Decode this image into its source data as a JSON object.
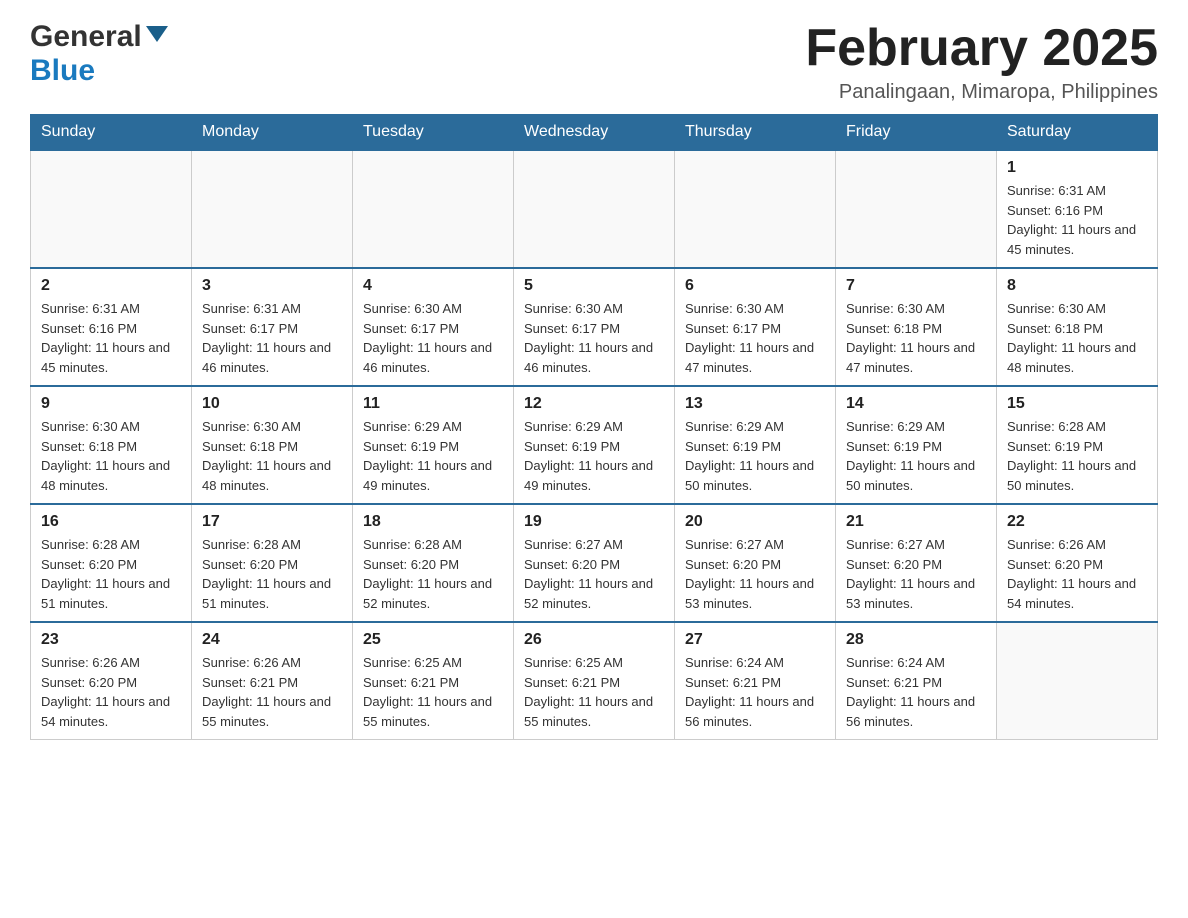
{
  "logo": {
    "general": "General",
    "blue": "Blue"
  },
  "header": {
    "title": "February 2025",
    "subtitle": "Panalingaan, Mimaropa, Philippines"
  },
  "days_of_week": [
    "Sunday",
    "Monday",
    "Tuesday",
    "Wednesday",
    "Thursday",
    "Friday",
    "Saturday"
  ],
  "weeks": [
    {
      "days": [
        {
          "number": "",
          "info": ""
        },
        {
          "number": "",
          "info": ""
        },
        {
          "number": "",
          "info": ""
        },
        {
          "number": "",
          "info": ""
        },
        {
          "number": "",
          "info": ""
        },
        {
          "number": "",
          "info": ""
        },
        {
          "number": "1",
          "info": "Sunrise: 6:31 AM\nSunset: 6:16 PM\nDaylight: 11 hours and 45 minutes."
        }
      ]
    },
    {
      "days": [
        {
          "number": "2",
          "info": "Sunrise: 6:31 AM\nSunset: 6:16 PM\nDaylight: 11 hours and 45 minutes."
        },
        {
          "number": "3",
          "info": "Sunrise: 6:31 AM\nSunset: 6:17 PM\nDaylight: 11 hours and 46 minutes."
        },
        {
          "number": "4",
          "info": "Sunrise: 6:30 AM\nSunset: 6:17 PM\nDaylight: 11 hours and 46 minutes."
        },
        {
          "number": "5",
          "info": "Sunrise: 6:30 AM\nSunset: 6:17 PM\nDaylight: 11 hours and 46 minutes."
        },
        {
          "number": "6",
          "info": "Sunrise: 6:30 AM\nSunset: 6:17 PM\nDaylight: 11 hours and 47 minutes."
        },
        {
          "number": "7",
          "info": "Sunrise: 6:30 AM\nSunset: 6:18 PM\nDaylight: 11 hours and 47 minutes."
        },
        {
          "number": "8",
          "info": "Sunrise: 6:30 AM\nSunset: 6:18 PM\nDaylight: 11 hours and 48 minutes."
        }
      ]
    },
    {
      "days": [
        {
          "number": "9",
          "info": "Sunrise: 6:30 AM\nSunset: 6:18 PM\nDaylight: 11 hours and 48 minutes."
        },
        {
          "number": "10",
          "info": "Sunrise: 6:30 AM\nSunset: 6:18 PM\nDaylight: 11 hours and 48 minutes."
        },
        {
          "number": "11",
          "info": "Sunrise: 6:29 AM\nSunset: 6:19 PM\nDaylight: 11 hours and 49 minutes."
        },
        {
          "number": "12",
          "info": "Sunrise: 6:29 AM\nSunset: 6:19 PM\nDaylight: 11 hours and 49 minutes."
        },
        {
          "number": "13",
          "info": "Sunrise: 6:29 AM\nSunset: 6:19 PM\nDaylight: 11 hours and 50 minutes."
        },
        {
          "number": "14",
          "info": "Sunrise: 6:29 AM\nSunset: 6:19 PM\nDaylight: 11 hours and 50 minutes."
        },
        {
          "number": "15",
          "info": "Sunrise: 6:28 AM\nSunset: 6:19 PM\nDaylight: 11 hours and 50 minutes."
        }
      ]
    },
    {
      "days": [
        {
          "number": "16",
          "info": "Sunrise: 6:28 AM\nSunset: 6:20 PM\nDaylight: 11 hours and 51 minutes."
        },
        {
          "number": "17",
          "info": "Sunrise: 6:28 AM\nSunset: 6:20 PM\nDaylight: 11 hours and 51 minutes."
        },
        {
          "number": "18",
          "info": "Sunrise: 6:28 AM\nSunset: 6:20 PM\nDaylight: 11 hours and 52 minutes."
        },
        {
          "number": "19",
          "info": "Sunrise: 6:27 AM\nSunset: 6:20 PM\nDaylight: 11 hours and 52 minutes."
        },
        {
          "number": "20",
          "info": "Sunrise: 6:27 AM\nSunset: 6:20 PM\nDaylight: 11 hours and 53 minutes."
        },
        {
          "number": "21",
          "info": "Sunrise: 6:27 AM\nSunset: 6:20 PM\nDaylight: 11 hours and 53 minutes."
        },
        {
          "number": "22",
          "info": "Sunrise: 6:26 AM\nSunset: 6:20 PM\nDaylight: 11 hours and 54 minutes."
        }
      ]
    },
    {
      "days": [
        {
          "number": "23",
          "info": "Sunrise: 6:26 AM\nSunset: 6:20 PM\nDaylight: 11 hours and 54 minutes."
        },
        {
          "number": "24",
          "info": "Sunrise: 6:26 AM\nSunset: 6:21 PM\nDaylight: 11 hours and 55 minutes."
        },
        {
          "number": "25",
          "info": "Sunrise: 6:25 AM\nSunset: 6:21 PM\nDaylight: 11 hours and 55 minutes."
        },
        {
          "number": "26",
          "info": "Sunrise: 6:25 AM\nSunset: 6:21 PM\nDaylight: 11 hours and 55 minutes."
        },
        {
          "number": "27",
          "info": "Sunrise: 6:24 AM\nSunset: 6:21 PM\nDaylight: 11 hours and 56 minutes."
        },
        {
          "number": "28",
          "info": "Sunrise: 6:24 AM\nSunset: 6:21 PM\nDaylight: 11 hours and 56 minutes."
        },
        {
          "number": "",
          "info": ""
        }
      ]
    }
  ]
}
